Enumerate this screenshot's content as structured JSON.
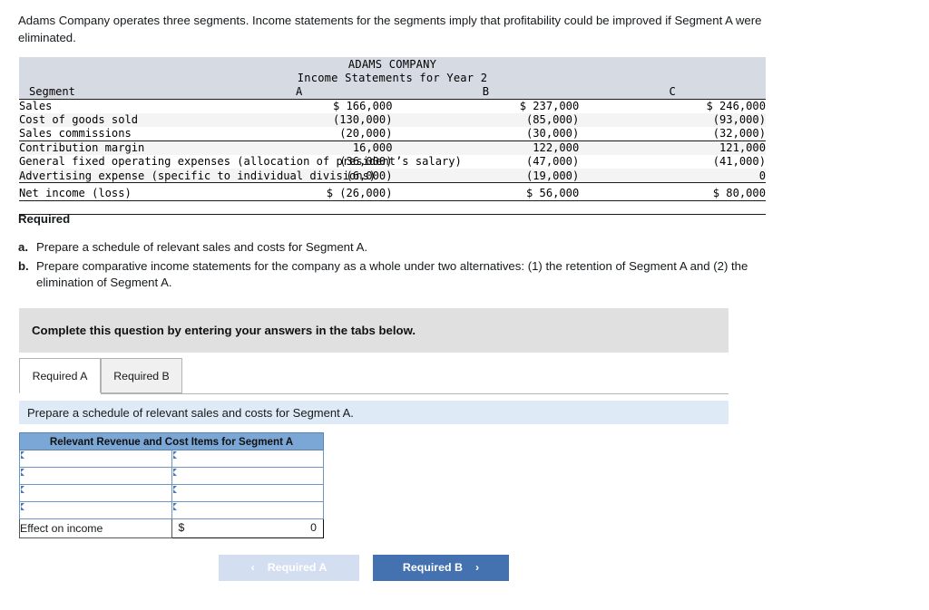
{
  "intro": {
    "text": "Adams Company operates three segments. Income statements for the segments imply that profitability could be improved if Segment A were eliminated."
  },
  "statement": {
    "company": "ADAMS COMPANY",
    "subtitle": "Income Statements for Year 2",
    "row_header_label": "Segment",
    "columns": [
      "A",
      "B",
      "C"
    ],
    "rows": [
      {
        "label": "Sales",
        "a": "$ 166,000",
        "b": "$ 237,000",
        "c": "$ 246,000"
      },
      {
        "label": "Cost of goods sold",
        "a": "(130,000)",
        "b": "(85,000)",
        "c": "(93,000)"
      },
      {
        "label": "Sales commissions",
        "a": "(20,000)",
        "b": "(30,000)",
        "c": "(32,000)"
      },
      {
        "label": "Contribution margin",
        "a": "16,000",
        "b": "122,000",
        "c": "121,000"
      },
      {
        "label": "General fixed operating expenses (allocation of president’s salary)",
        "a": "(36,000)",
        "b": "(47,000)",
        "c": "(41,000)"
      },
      {
        "label": "Advertising expense (specific to individual divisions)",
        "a": "(6,000)",
        "b": "(19,000)",
        "c": "0"
      }
    ],
    "net_row": {
      "label": "Net income (loss)",
      "a": "$ (26,000)",
      "b": "$ 56,000",
      "c": "$ 80,000"
    }
  },
  "required": {
    "heading": "Required",
    "items": [
      {
        "marker": "a.",
        "text": "Prepare a schedule of relevant sales and costs for Segment A."
      },
      {
        "marker": "b.",
        "text": "Prepare comparative income statements for the company as a whole under two alternatives: (1) the retention of Segment A and (2) the elimination of Segment A."
      }
    ]
  },
  "banner": {
    "text": "Complete this question by entering your answers in the tabs below."
  },
  "tabs": [
    {
      "label": "Required A",
      "active": true
    },
    {
      "label": "Required B",
      "active": false
    }
  ],
  "tab_instruction": {
    "text": "Prepare a schedule of relevant sales and costs for Segment A."
  },
  "answer_table": {
    "title": "Relevant Revenue and Cost Items for Segment A",
    "input_rows": [
      {
        "left": "",
        "right": ""
      },
      {
        "left": "",
        "right": ""
      },
      {
        "left": "",
        "right": ""
      },
      {
        "left": "",
        "right": ""
      }
    ],
    "total_row": {
      "label": "Effect on income",
      "currency": "$",
      "value": "0"
    }
  },
  "nav": {
    "prev": {
      "label": "Required A",
      "chevron": "‹",
      "enabled": false
    },
    "next": {
      "label": "Required B",
      "chevron": "›",
      "enabled": true
    }
  },
  "colors": {
    "statement_header_bg": "#d6dae2",
    "statement_alt_row": "#f4f4f5",
    "banner_bg": "#e0e0e0",
    "instruction_bg": "#dfeaf7",
    "table_title_bg": "#7ba7d7",
    "input_border": "#6e95c4",
    "primary_button": "#4472b0",
    "disabled_button": "#d3dff0"
  }
}
